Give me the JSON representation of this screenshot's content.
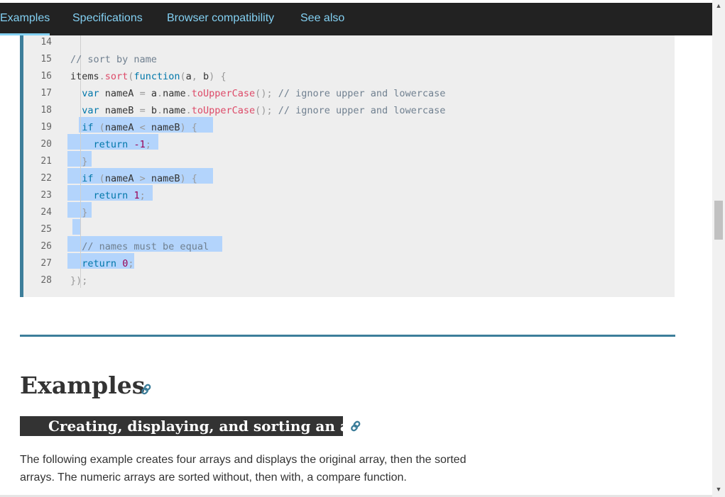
{
  "nav": {
    "tabs": [
      "Examples",
      "Specifications",
      "Browser compatibility",
      "See also"
    ],
    "active_tab": "Examples"
  },
  "code": {
    "line_numbers": [
      "14",
      "15",
      "16",
      "17",
      "18",
      "19",
      "20",
      "21",
      "22",
      "23",
      "24",
      "25",
      "26",
      "27",
      "28"
    ],
    "lines": [
      "",
      "// sort by name",
      "items.sort(function(a, b) {",
      "  var nameA = a.name.toUpperCase(); // ignore upper and lowercase",
      "  var nameB = b.name.toUpperCase(); // ignore upper and lowercase",
      "  if (nameA < nameB) {",
      "    return -1;",
      "  }",
      "  if (nameA > nameB) {",
      "    return 1;",
      "  }",
      "",
      "  // names must be equal",
      "  return 0;",
      "});"
    ]
  },
  "section": {
    "heading": "Examples",
    "subheading": "Creating, displaying, and sorting an array",
    "paragraph": "The following example creates four arrays and displays the original array, then the sorted arrays. The numeric arrays are sorted without, then with, a compare function."
  },
  "icons": {
    "heading_link": "link-icon",
    "subheading_link": "link-icon",
    "scroll_up": "arrow-up-icon",
    "scroll_down": "arrow-down-icon"
  },
  "colors": {
    "nav_bg": "#222222",
    "nav_link": "#83d0f2",
    "accent": "#3d7e9a",
    "code_bg": "#eeeeee",
    "selection": "#b3d4fc"
  }
}
